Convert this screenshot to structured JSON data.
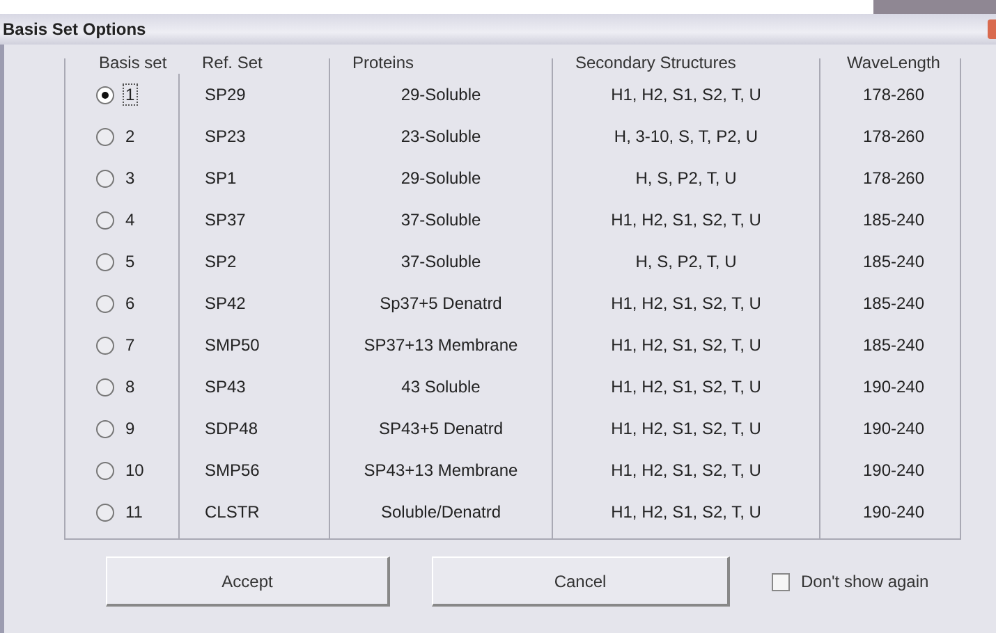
{
  "window": {
    "title": "Basis Set Options"
  },
  "columns": [
    "Basis set",
    "Ref. Set",
    "Proteins",
    "Secondary Structures",
    "WaveLength"
  ],
  "rows": [
    {
      "label": "1",
      "selected": true,
      "ref_set": "SP29",
      "proteins": "29-Soluble",
      "secondary": "H1, H2, S1, S2, T, U",
      "wavelength": "178-260"
    },
    {
      "label": "2",
      "selected": false,
      "ref_set": "SP23",
      "proteins": "23-Soluble",
      "secondary": "H, 3-10, S, T, P2, U",
      "wavelength": "178-260"
    },
    {
      "label": "3",
      "selected": false,
      "ref_set": "SP1",
      "proteins": "29-Soluble",
      "secondary": "H, S, P2, T, U",
      "wavelength": "178-260"
    },
    {
      "label": "4",
      "selected": false,
      "ref_set": "SP37",
      "proteins": "37-Soluble",
      "secondary": "H1, H2, S1, S2, T, U",
      "wavelength": "185-240"
    },
    {
      "label": "5",
      "selected": false,
      "ref_set": "SP2",
      "proteins": "37-Soluble",
      "secondary": "H, S, P2, T, U",
      "wavelength": "185-240"
    },
    {
      "label": "6",
      "selected": false,
      "ref_set": "SP42",
      "proteins": "Sp37+5 Denatrd",
      "secondary": "H1, H2, S1, S2, T, U",
      "wavelength": "185-240"
    },
    {
      "label": "7",
      "selected": false,
      "ref_set": "SMP50",
      "proteins": "SP37+13 Membrane",
      "secondary": "H1, H2, S1, S2, T, U",
      "wavelength": "185-240"
    },
    {
      "label": "8",
      "selected": false,
      "ref_set": "SP43",
      "proteins": "43 Soluble",
      "secondary": "H1, H2, S1, S2, T, U",
      "wavelength": "190-240"
    },
    {
      "label": "9",
      "selected": false,
      "ref_set": "SDP48",
      "proteins": "SP43+5 Denatrd",
      "secondary": "H1, H2, S1, S2, T, U",
      "wavelength": "190-240"
    },
    {
      "label": "10",
      "selected": false,
      "ref_set": "SMP56",
      "proteins": "SP43+13 Membrane",
      "secondary": "H1, H2, S1, S2, T, U",
      "wavelength": "190-240"
    },
    {
      "label": "11",
      "selected": false,
      "ref_set": "CLSTR",
      "proteins": "Soluble/Denatrd",
      "secondary": "H1, H2, S1, S2, T, U",
      "wavelength": "190-240"
    }
  ],
  "buttons": [
    "Accept",
    "Cancel"
  ],
  "dont_show_again": {
    "label": "Don't show again",
    "checked": false
  }
}
